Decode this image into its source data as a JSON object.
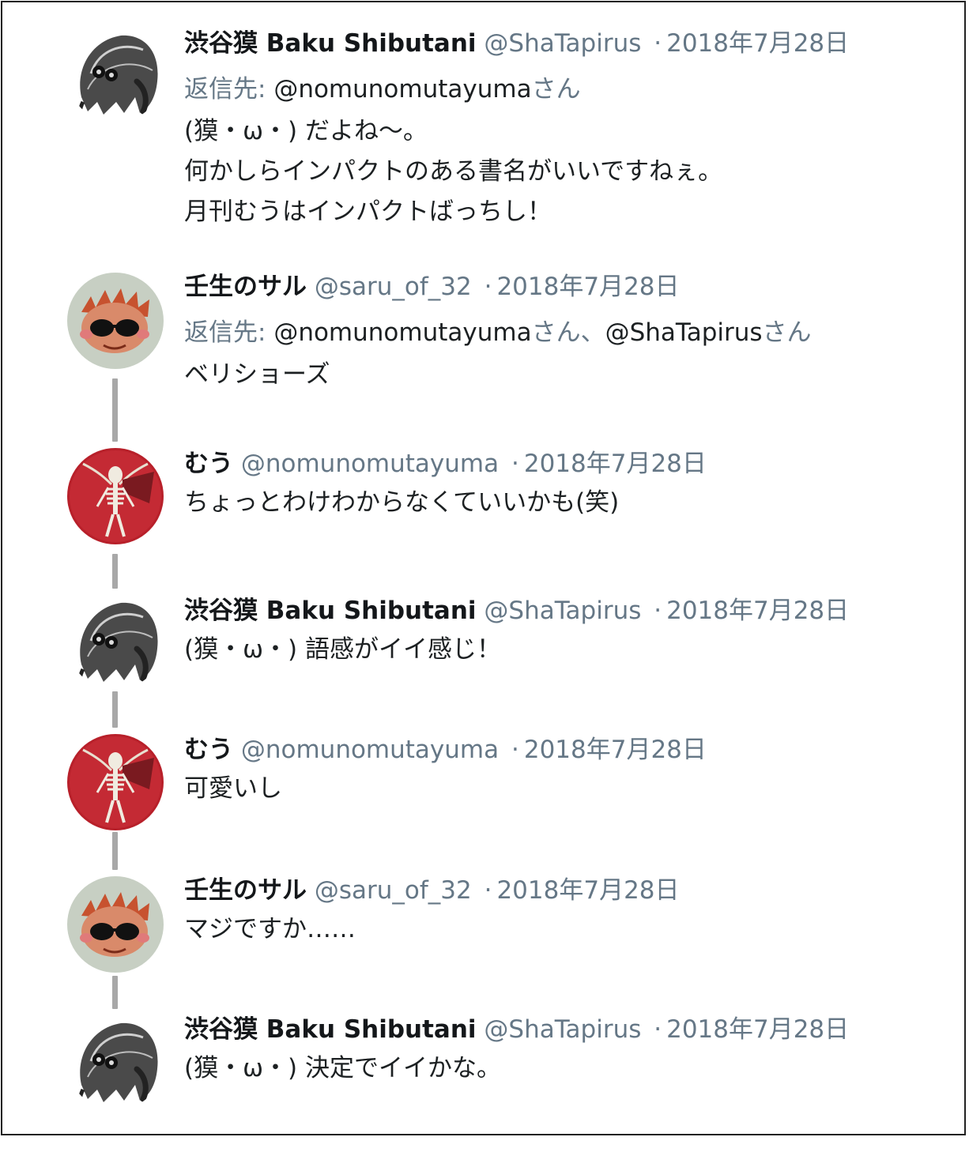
{
  "tweets": [
    {
      "name": "渋谷獏 Baku Shibutani",
      "handle": "@ShaTapirus",
      "sep": "·",
      "date": "2018年7月28日",
      "avatar": "tapir-avatar",
      "reply_prefix": "返信先: ",
      "reply_mentions": [
        {
          "handle": "@nomunomutayuma",
          "suffix": "さん"
        }
      ],
      "text": "(獏・ω・) だよね〜。\n何かしらインパクトのある書名がいいですねぇ。\n月刊むうはインパクトばっちし！"
    },
    {
      "name": "壬生のサル",
      "handle": "@saru_of_32",
      "sep": "·",
      "date": "2018年7月28日",
      "avatar": "monkey-avatar",
      "reply_prefix": "返信先: ",
      "reply_mentions": [
        {
          "handle": "@nomunomutayuma",
          "suffix": "さん、"
        },
        {
          "handle": "@ShaTapirus",
          "suffix": "さん"
        }
      ],
      "text": "ベリショーズ"
    },
    {
      "name": "むう",
      "handle": "@nomunomutayuma",
      "sep": "·",
      "date": "2018年7月28日",
      "avatar": "skeleton-avatar",
      "text": "ちょっとわけわからなくていいかも(笑)"
    },
    {
      "name": "渋谷獏 Baku Shibutani",
      "handle": "@ShaTapirus",
      "sep": "·",
      "date": "2018年7月28日",
      "avatar": "tapir-avatar",
      "text": "(獏・ω・) 語感がイイ感じ！"
    },
    {
      "name": "むう",
      "handle": "@nomunomutayuma",
      "sep": "·",
      "date": "2018年7月28日",
      "avatar": "skeleton-avatar",
      "text": "可愛いし"
    },
    {
      "name": "壬生のサル",
      "handle": "@saru_of_32",
      "sep": "·",
      "date": "2018年7月28日",
      "avatar": "monkey-avatar",
      "text": "マジですか……"
    },
    {
      "name": "渋谷獏 Baku Shibutani",
      "handle": "@ShaTapirus",
      "sep": "·",
      "date": "2018年7月28日",
      "avatar": "tapir-avatar",
      "text": "(獏・ω・) 決定でイイかな。"
    }
  ],
  "colors": {
    "handle": "#657786",
    "thread_line": "#a8a8a8",
    "text": "#1c2022"
  }
}
